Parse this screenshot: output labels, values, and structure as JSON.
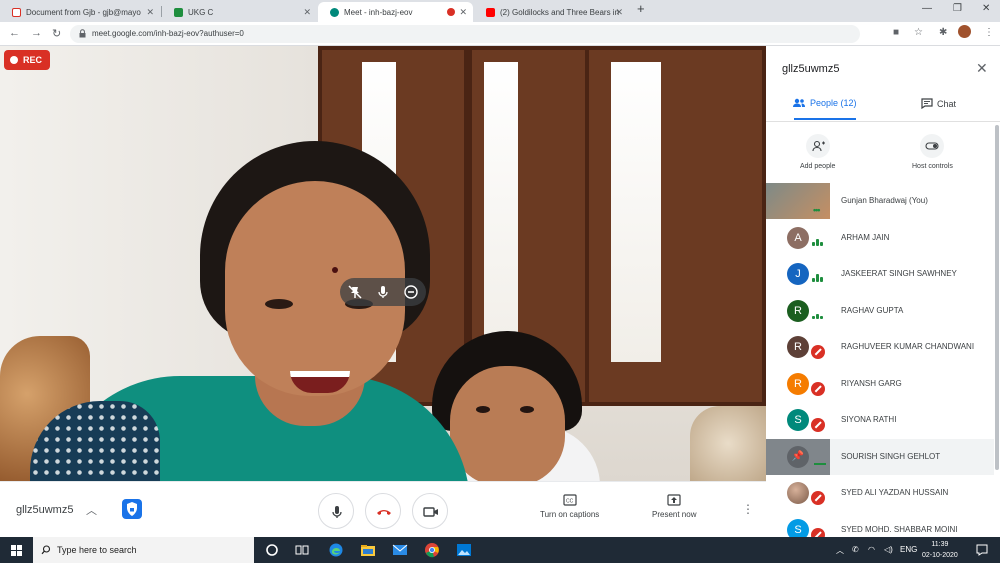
{
  "browser": {
    "tabs": [
      {
        "title": "Document from Gjb - gjb@mayo",
        "icon": "gmail-icon",
        "color": "#d93025"
      },
      {
        "title": "UKG C",
        "icon": "classroom-icon",
        "color": "#1e8e3e"
      },
      {
        "title": "Meet - inh-bazj-eov",
        "icon": "meet-icon",
        "color": "#00897b",
        "active": true
      },
      {
        "title": "(2) Goldilocks and Three Bears in",
        "icon": "youtube-icon",
        "color": "#ff0000"
      }
    ],
    "url": "meet.google.com/inh-bazj-eov?authuser=0"
  },
  "meeting": {
    "rec_label": "REC",
    "code": "gllz5uwmz5",
    "captions_label": "Turn on captions",
    "present_label": "Present now"
  },
  "panel": {
    "title": "gllz5uwmz5",
    "people_tab": "People (12)",
    "chat_tab": "Chat",
    "add_people": "Add people",
    "host_controls": "Host controls",
    "participants": [
      {
        "name": "Gunjan Bharadwaj (You)",
        "initial": "",
        "color": "",
        "status": "talking-dots",
        "avatar": "photo"
      },
      {
        "name": "ARHAM JAIN",
        "initial": "A",
        "color": "#8d6e63",
        "status": "talking"
      },
      {
        "name": "JASKEERAT SINGH SAWHNEY",
        "initial": "J",
        "color": "#1565c0",
        "status": "talking"
      },
      {
        "name": "RAGHAV GUPTA",
        "initial": "R",
        "color": "#1b5e20",
        "status": "talking"
      },
      {
        "name": "RAGHUVEER KUMAR CHANDWANI",
        "initial": "R",
        "color": "#5d4037",
        "status": "muted"
      },
      {
        "name": "RIYANSH GARG",
        "initial": "R",
        "color": "#f57c00",
        "status": "muted"
      },
      {
        "name": "SIYONA RATHI",
        "initial": "S",
        "color": "#00897b",
        "status": "muted"
      },
      {
        "name": "SOURISH SINGH GEHLOT",
        "initial": "",
        "color": "#5f6368",
        "status": "pinned",
        "avatar": "tile",
        "highlighted": true
      },
      {
        "name": "SYED ALI YAZDAN HUSSAIN",
        "initial": "",
        "color": "#ad8f7a",
        "status": "muted",
        "avatar": "photo-small"
      },
      {
        "name": "SYED MOHD. SHABBAR MOINI",
        "initial": "S",
        "color": "#039be5",
        "status": "muted"
      }
    ]
  },
  "taskbar": {
    "search_placeholder": "Type here to search",
    "lang": "ENG",
    "time": "11:39",
    "date": "02-10-2020"
  }
}
